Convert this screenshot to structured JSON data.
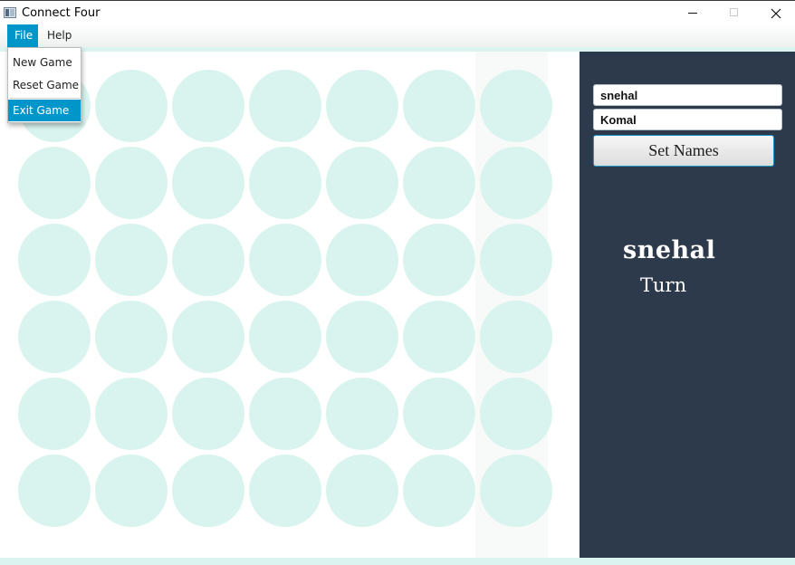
{
  "window": {
    "title": "Connect Four",
    "app_icon": "window-icon",
    "controls": [
      "minimize-icon",
      "maximize-icon",
      "close-icon"
    ]
  },
  "menubar": {
    "file_label": "File",
    "help_label": "Help"
  },
  "file_menu": {
    "open": true,
    "items": [
      "New Game",
      "Reset Game",
      "Exit Game"
    ],
    "highlighted": "Exit Game"
  },
  "board": {
    "rows": 6,
    "columns": 7,
    "hover_column": 6,
    "hole_color": "#d9f4ee",
    "discs": []
  },
  "players": {
    "player_one": "snehal",
    "player_two": "Komal",
    "set_names_label": "Set Names"
  },
  "turn": {
    "current_player": "snehal",
    "label": "Turn"
  },
  "colors": {
    "accent": "#0096c9",
    "side_panel": "#2c3a4b",
    "board_background": "#ffffff",
    "stripe": "#dcf4f0"
  }
}
